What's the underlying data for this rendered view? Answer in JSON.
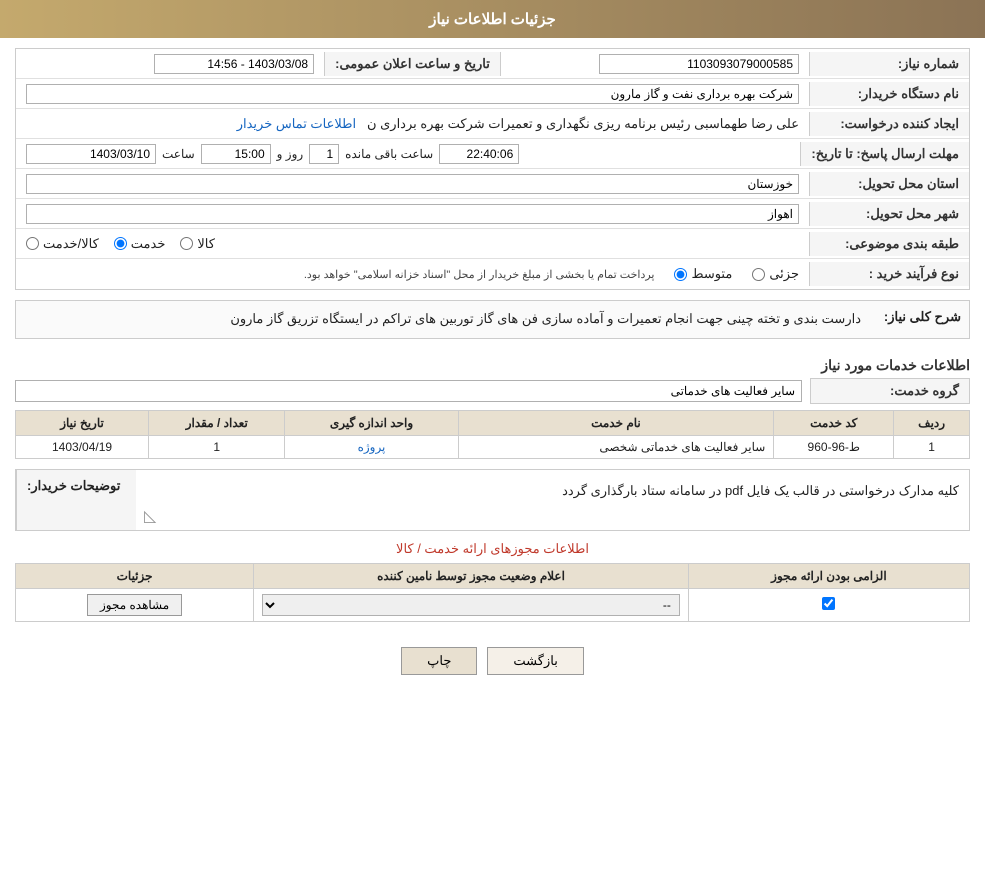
{
  "header": {
    "title": "جزئیات اطلاعات نیاز"
  },
  "fields": {
    "shomareNiaz_label": "شماره نیاز:",
    "shomareNiaz_value": "1103093079000585",
    "namDastgah_label": "نام دستگاه خریدار:",
    "namDastgah_value": "شرکت بهره برداری نفت و گاز مارون",
    "ejadKonande_label": "ایجاد کننده درخواست:",
    "ejadKonande_value": "علی رضا طهماسبی رئیس برنامه ریزی نگهداری و تعمیرات شرکت بهره برداری ن",
    "ejadKonande_link": "اطلاعات تماس خریدار",
    "mohlatErsal_label": "مهلت ارسال پاسخ: تا تاریخ:",
    "tarikhDate": "1403/03/10",
    "tarikhSaat_label": "ساعت",
    "tarikhSaat": "15:00",
    "roozO_label": "روز و",
    "countdown": "1",
    "saatMande_label": "ساعت باقی مانده",
    "countdownTime": "22:40:06",
    "publicDateTime_label": "تاریخ و ساعت اعلان عمومی:",
    "publicDateTime": "1403/03/08 - 14:56",
    "ostanTahvil_label": "استان محل تحویل:",
    "ostanTahvil_value": "خوزستان",
    "shahrTahvil_label": "شهر محل تحویل:",
    "shahrTahvil_value": "اهواز",
    "tabaqebandiLabel": "طبقه بندی موضوعی:",
    "tabaqebandiOptions": [
      {
        "label": "کالا",
        "selected": false
      },
      {
        "label": "خدمت",
        "selected": true
      },
      {
        "label": "کالا/خدمت",
        "selected": false
      }
    ],
    "naveFarayand_label": "نوع فرآیند خرید :",
    "naveFarayandOptions": [
      {
        "label": "جزئی",
        "selected": false
      },
      {
        "label": "متوسط",
        "selected": true
      }
    ],
    "naveFarayand_note": "پرداخت تمام یا بخشی از مبلغ خریدار از محل \"اسناد خزانه اسلامی\" خواهد بود."
  },
  "sharh": {
    "label": "شرح کلی نیاز:",
    "text": "دارست بندی و تخته چینی جهت انجام تعمیرات و آماده سازی فن های گاز توربین های تراکم در ایستگاه تزریق گاز مارون"
  },
  "khadamat": {
    "section_title": "اطلاعات خدمات مورد نیاز",
    "grouh_label": "گروه خدمت:",
    "grouh_value": "سایر فعالیت های خدماتی",
    "table_headers": [
      "ردیف",
      "کد خدمت",
      "نام خدمت",
      "واحد اندازه گیری",
      "تعداد / مقدار",
      "تاریخ نیاز"
    ],
    "table_rows": [
      {
        "rowNum": "1",
        "code": "ط-96-960",
        "name": "سایر فعالیت های خدماتی شخصی",
        "unit": "پروژه",
        "count": "1",
        "date": "1403/04/19"
      }
    ]
  },
  "buyerNotes": {
    "label": "توضیحات خریدار:",
    "text": "کلیه مدارک درخواستی در قالب یک فایل pdf در سامانه ستاد بارگذاری گردد"
  },
  "permitsSection": {
    "link_text": "اطلاعات مجوزهای ارائه خدمت / کالا",
    "table_headers": [
      "الزامی بودن ارائه مجوز",
      "اعلام وضعیت مجوز توسط نامین کننده",
      "جزئیات"
    ],
    "table_rows": [
      {
        "required": true,
        "status": "--",
        "detail_btn": "مشاهده مجوز"
      }
    ]
  },
  "buttons": {
    "print": "چاپ",
    "back": "بازگشت"
  }
}
